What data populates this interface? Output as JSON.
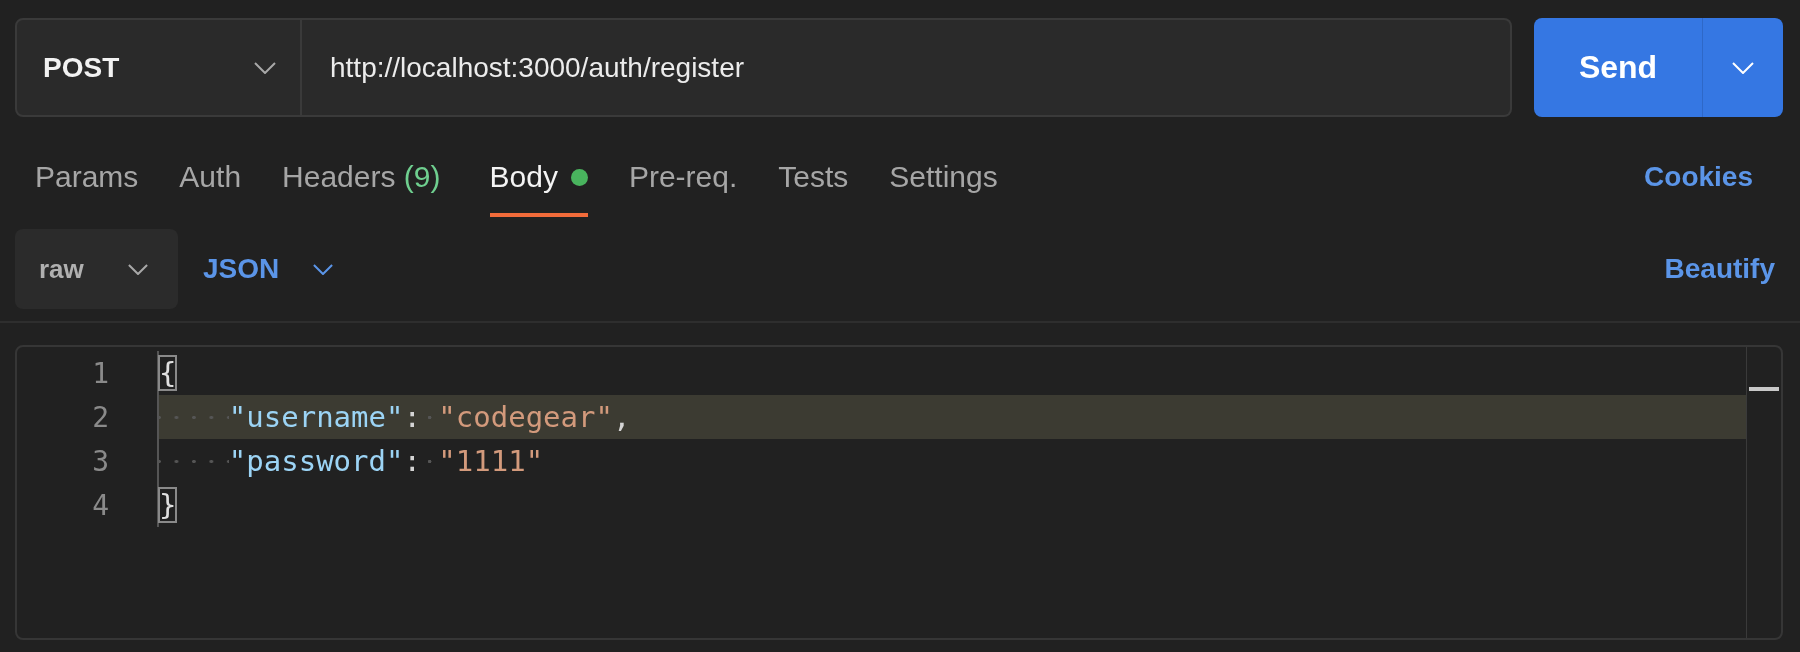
{
  "request": {
    "method": "POST",
    "url": "http://localhost:3000/auth/register",
    "send_label": "Send"
  },
  "tabs": [
    {
      "label": "Params",
      "selected": false
    },
    {
      "label": "Auth",
      "selected": false
    },
    {
      "label": "Headers",
      "count": "(9)",
      "selected": false
    },
    {
      "label": "Body",
      "has_content": true,
      "selected": true
    },
    {
      "label": "Pre-req.",
      "selected": false
    },
    {
      "label": "Tests",
      "selected": false
    },
    {
      "label": "Settings",
      "selected": false
    }
  ],
  "cookies_link": "Cookies",
  "body_options": {
    "mode": "raw",
    "language": "JSON",
    "beautify_link": "Beautify"
  },
  "editor": {
    "lines": [
      {
        "number": "1",
        "highlighted": false,
        "tokens": [
          {
            "kind": "brace",
            "text": "{",
            "matched": true
          }
        ]
      },
      {
        "number": "2",
        "highlighted": true,
        "tokens": [
          {
            "kind": "indent"
          },
          {
            "kind": "key",
            "text": "\"username\""
          },
          {
            "kind": "punct",
            "text": ":"
          },
          {
            "kind": "space"
          },
          {
            "kind": "string",
            "text": "\"codegear\""
          },
          {
            "kind": "punct",
            "text": ","
          }
        ]
      },
      {
        "number": "3",
        "highlighted": false,
        "tokens": [
          {
            "kind": "indent"
          },
          {
            "kind": "key",
            "text": "\"password\""
          },
          {
            "kind": "punct",
            "text": ":"
          },
          {
            "kind": "space"
          },
          {
            "kind": "string",
            "text": "\"1111\""
          }
        ]
      },
      {
        "number": "4",
        "highlighted": false,
        "tokens": [
          {
            "kind": "brace",
            "text": "}",
            "matched": true
          }
        ]
      }
    ]
  }
}
